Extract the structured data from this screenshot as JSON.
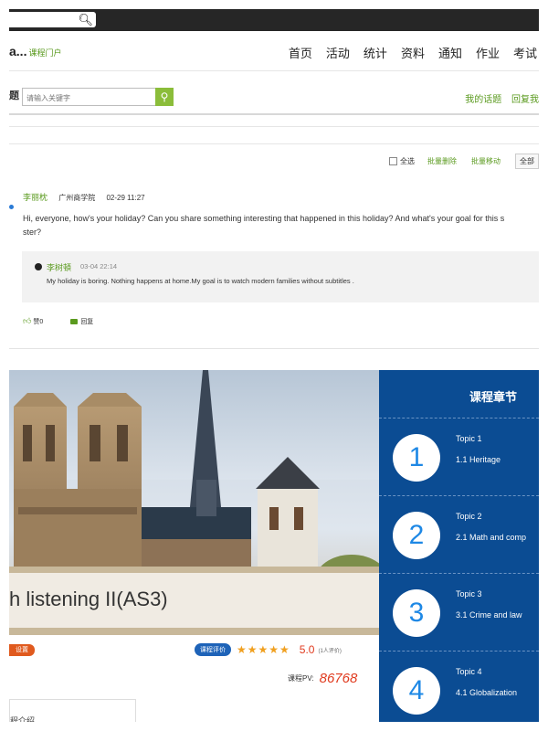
{
  "nav": {
    "brand": "a...",
    "brand_sub": "课程门户",
    "links": [
      "首页",
      "活动",
      "统计",
      "资料",
      "通知",
      "作业",
      "考试"
    ]
  },
  "search": {
    "left_glyph": "题",
    "placeholder": "请输入关键字",
    "right_links": [
      "我的话题",
      "回复我"
    ]
  },
  "toolbar": {
    "select_all": "全选",
    "batch_delete": "批量删除",
    "batch_move": "批量移动",
    "all": "全部"
  },
  "post": {
    "author": "李丽枕",
    "school": "广州商学院",
    "time": "02-29 11:27",
    "text_line1": "Hi, everyone, how's your holiday? Can you share something interesting that happened in this holiday? And what's your goal for this s",
    "text_line2": "ster?",
    "reply": {
      "author": "李树頓",
      "time": "03-04 22:14",
      "text": "My holiday is boring. Nothing happens at home.My goal is to watch modern families without subtitles ."
    },
    "like_label": "赞0",
    "reply_label": "回复"
  },
  "course": {
    "title": "h listening II(AS3)",
    "badge": "设置",
    "rating_pill": "课程评价",
    "stars": "★★★★★",
    "score": "5.0",
    "rating_count": "(1人评价)",
    "pv_label": "课程PV:",
    "pv_value": "86768",
    "tab_label": "程介绍"
  },
  "chapters": {
    "title": "课程章节",
    "items": [
      {
        "num": "1",
        "topic": "Topic 1",
        "sub": "1.1  Heritage"
      },
      {
        "num": "2",
        "topic": "Topic 2",
        "sub": "2.1  Math and comp"
      },
      {
        "num": "3",
        "topic": "Topic 3",
        "sub": "3.1  Crime and law"
      },
      {
        "num": "4",
        "topic": "Topic 4",
        "sub": "4.1  Globalization"
      }
    ]
  },
  "colors": {
    "accent_green": "#5a9a1e",
    "chapter_blue": "#0b4c93",
    "pv_red": "#e03a1e"
  }
}
